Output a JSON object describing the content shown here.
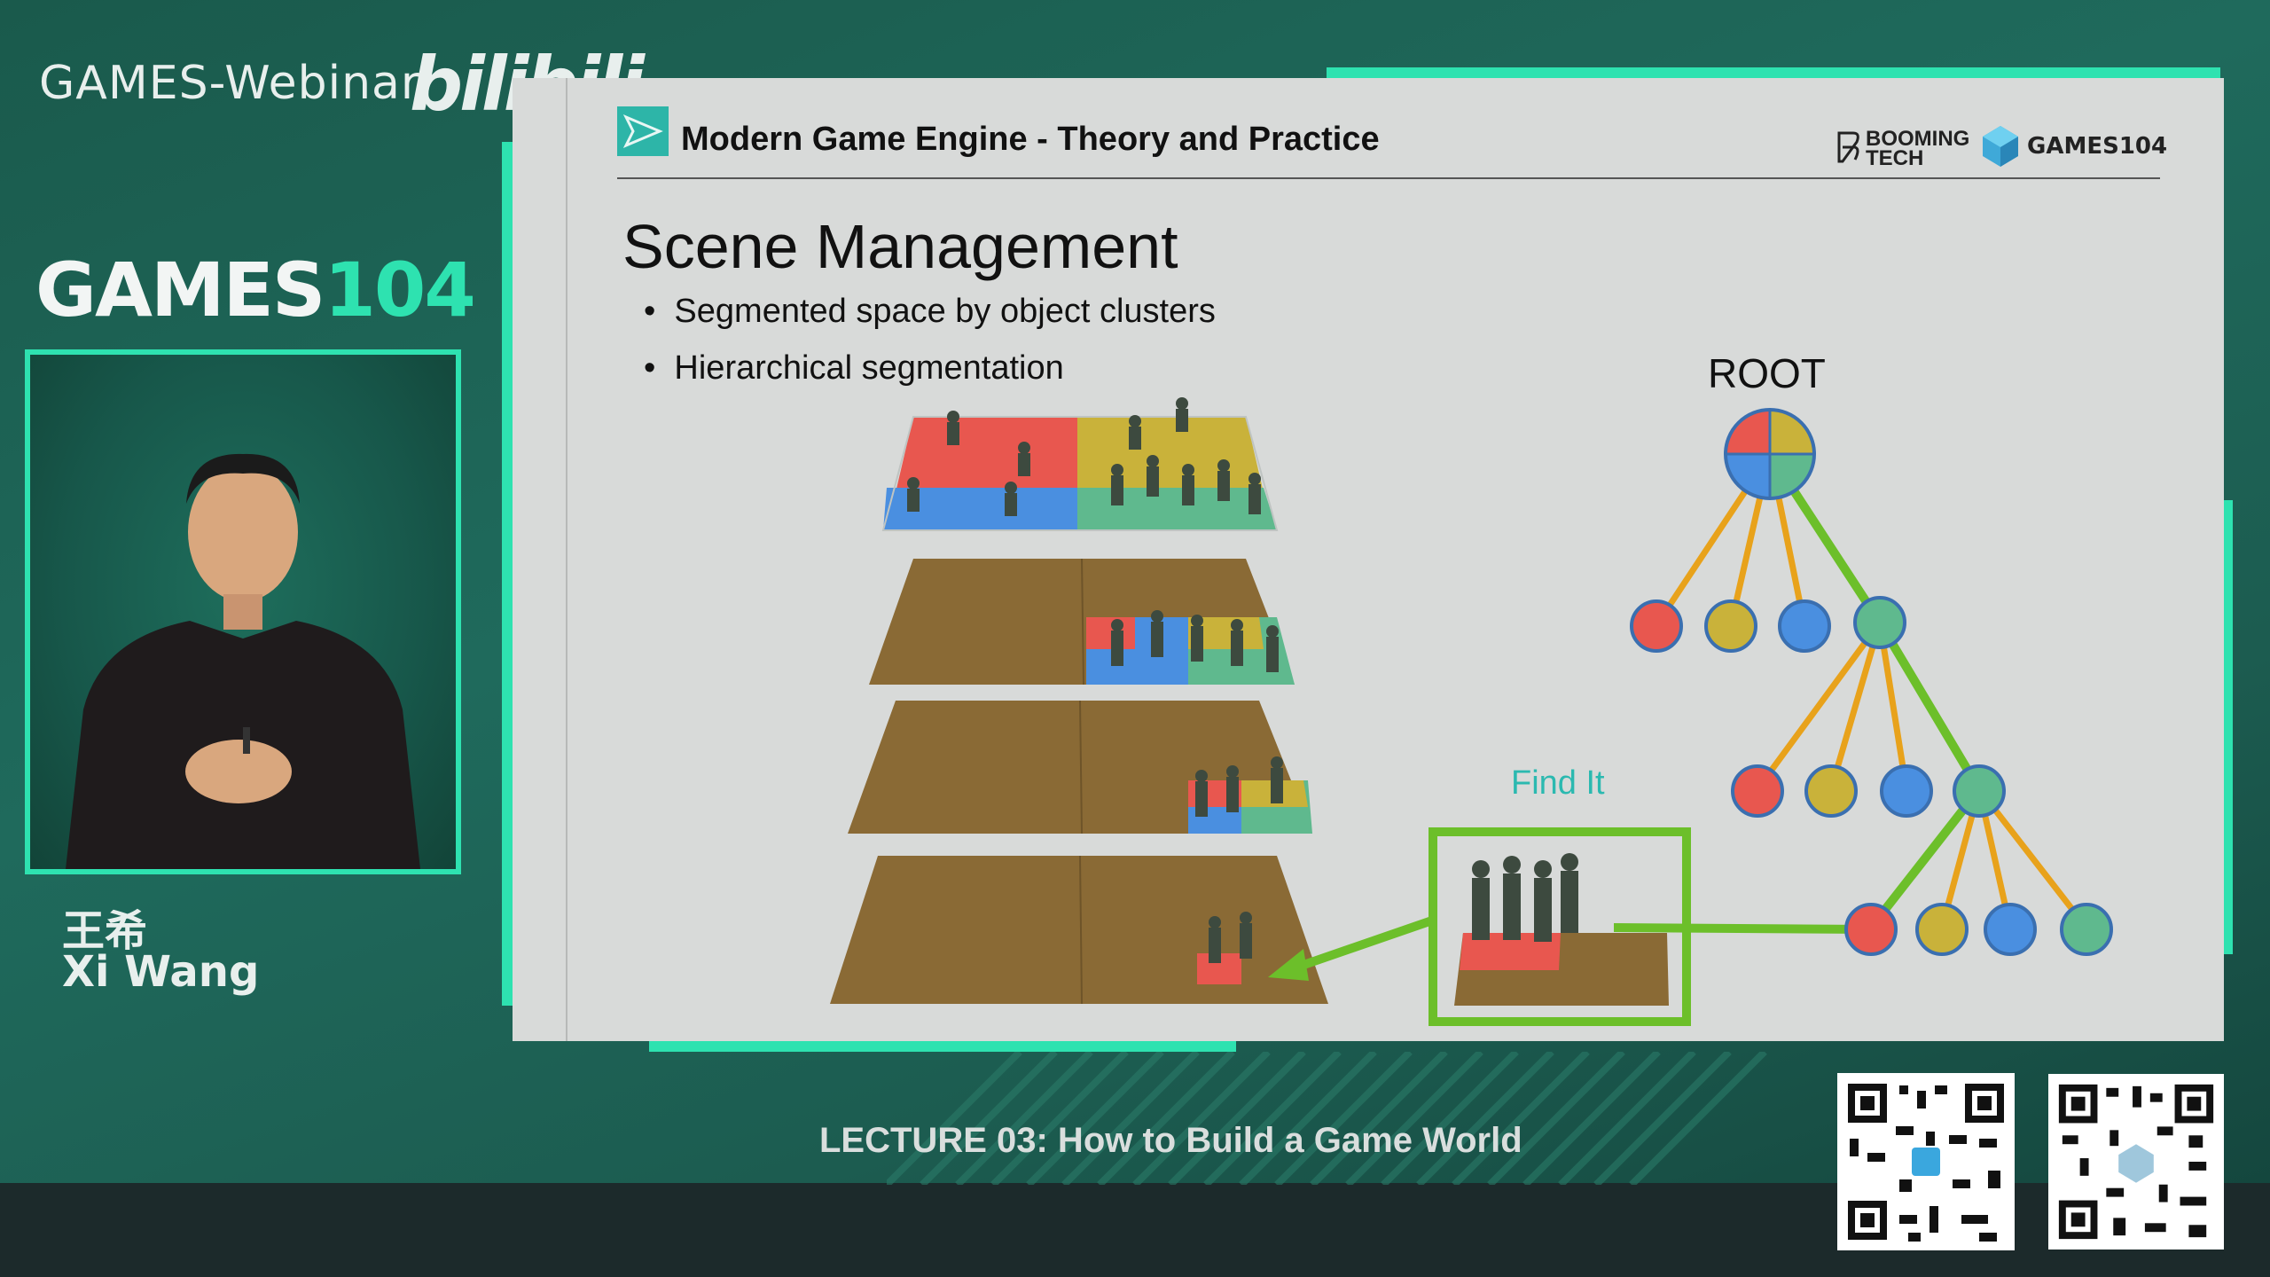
{
  "header": {
    "brand": "GAMES-Webinar",
    "platform_logo": "bilibili",
    "course_logo_white": "GAMES",
    "course_logo_green": "104"
  },
  "speaker": {
    "name_cn": "王希",
    "name_en": "Xi Wang"
  },
  "slide": {
    "course_title": "Modern Game Engine - Theory and Practice",
    "logo_booming_line1": "BOOMING",
    "logo_booming_line2": "TECH",
    "logo_games104": "GAMES104",
    "heading": "Scene Management",
    "bullets": [
      "Segmented space by object clusters",
      "Hierarchical segmentation"
    ],
    "tree_root_label": "ROOT",
    "find_label": "Find It"
  },
  "footer": {
    "lecture": "LECTURE 03:  How to Build a Game World"
  },
  "colors": {
    "accent": "#2ee2b0",
    "red": "#e8574f",
    "yellow": "#c9b23a",
    "blue": "#4a8fe0",
    "green": "#5fb98e",
    "ground": "#8a6a35",
    "highlight": "#6cbf2a",
    "branch": "#e8a21b"
  },
  "icons": [
    "play-logo-icon",
    "booming-tech-logo",
    "games104-logo",
    "qr-code"
  ]
}
